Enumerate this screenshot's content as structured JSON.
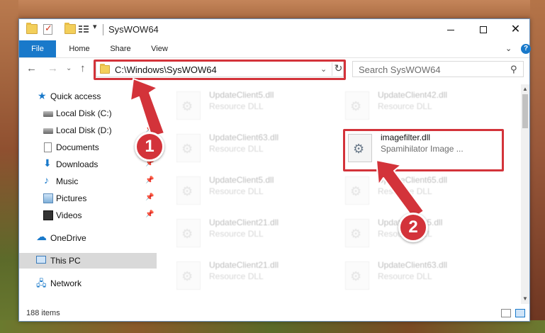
{
  "window": {
    "title": "SysWOW64"
  },
  "ribbon": {
    "tabs": [
      "File",
      "Home",
      "Share",
      "View"
    ],
    "help": "?"
  },
  "nav": {
    "address": "C:\\Windows\\SysWOW64",
    "search_placeholder": "Search SysWOW64"
  },
  "sidebar": {
    "items": [
      {
        "label": "Quick access",
        "icon": "star-icon",
        "pinned": false
      },
      {
        "label": "Local Disk (C:)",
        "icon": "disk-icon",
        "pinned": true
      },
      {
        "label": "Local Disk (D:)",
        "icon": "disk-icon",
        "pinned": true
      },
      {
        "label": "Documents",
        "icon": "document-icon",
        "pinned": true
      },
      {
        "label": "Downloads",
        "icon": "download-icon",
        "pinned": true
      },
      {
        "label": "Music",
        "icon": "music-icon",
        "pinned": true
      },
      {
        "label": "Pictures",
        "icon": "pictures-icon",
        "pinned": true
      },
      {
        "label": "Videos",
        "icon": "videos-icon",
        "pinned": true
      },
      {
        "label": "OneDrive",
        "icon": "cloud-icon",
        "pinned": false
      },
      {
        "label": "This PC",
        "icon": "computer-icon",
        "pinned": false,
        "selected": true
      },
      {
        "label": "Network",
        "icon": "network-icon",
        "pinned": false
      }
    ]
  },
  "files": [
    {
      "name": "UpdateClient5.dll",
      "desc": "Resource DLL",
      "faded": true
    },
    {
      "name": "UpdateClient42.dll",
      "desc": "Resource DLL",
      "faded": true
    },
    {
      "name": "UpdateClient63.dll",
      "desc": "Resource DLL",
      "faded": true
    },
    {
      "name": "imagefilter.dll",
      "desc": "Spamihilator Image ...",
      "faded": false
    },
    {
      "name": "UpdateClient5.dll",
      "desc": "Resource DLL",
      "faded": true
    },
    {
      "name": "UpdateClient65.dll",
      "desc": "Resource DLL",
      "faded": true
    },
    {
      "name": "UpdateClient21.dll",
      "desc": "Resource DLL",
      "faded": true
    },
    {
      "name": "UpdateClient5.dll",
      "desc": "Resource DLL",
      "faded": true
    },
    {
      "name": "UpdateClient21.dll",
      "desc": "Resource DLL",
      "faded": true
    },
    {
      "name": "UpdateClient63.dll",
      "desc": "Resource DLL",
      "faded": true
    }
  ],
  "status": {
    "item_count": "188 items"
  },
  "annotations": {
    "step1": "1",
    "step2": "2",
    "color": "#d3333a"
  },
  "colors": {
    "accent": "#1979ca"
  }
}
